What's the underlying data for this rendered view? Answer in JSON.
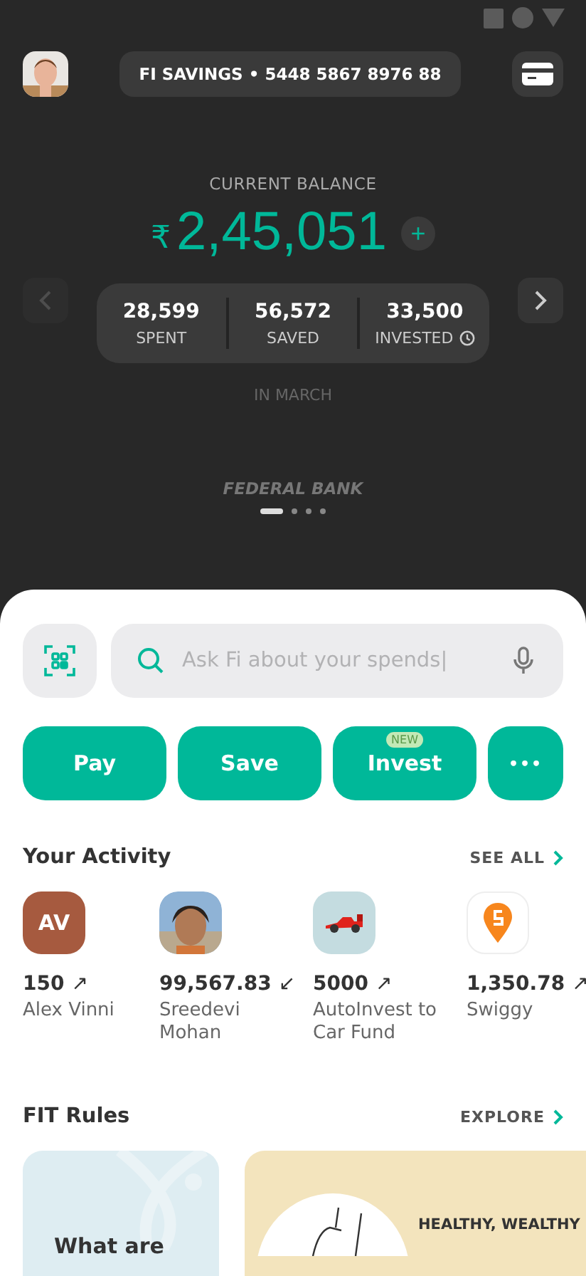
{
  "header": {
    "account": "FI SAVINGS • 5448 5867 8976 88"
  },
  "balance": {
    "label": "CURRENT BALANCE",
    "currency": "₹",
    "amount": "2,45,051",
    "plus": "+"
  },
  "nav": {
    "prev_disabled": true,
    "next_disabled": false
  },
  "stats": [
    {
      "value": "28,599",
      "label": "SPENT",
      "clock": false
    },
    {
      "value": "56,572",
      "label": "SAVED",
      "clock": false
    },
    {
      "value": "33,500",
      "label": "INVESTED",
      "clock": true
    }
  ],
  "period": "IN MARCH",
  "bank": "FEDERAL BANK",
  "pages": [
    {
      "selected": true
    },
    {
      "selected": false
    },
    {
      "selected": false
    },
    {
      "selected": false
    }
  ],
  "search": {
    "placeholder": "Ask Fi about your spends|"
  },
  "actions": [
    {
      "kind": "label",
      "label": "Pay"
    },
    {
      "kind": "label",
      "label": "Save"
    },
    {
      "kind": "label",
      "label": "Invest",
      "badge": "NEW"
    },
    {
      "kind": "more",
      "label": "•••"
    }
  ],
  "activity": {
    "title": "Your Activity",
    "link": "SEE ALL",
    "items": [
      {
        "kind": "initials",
        "initials": "AV",
        "color": "#a65a3f",
        "amount": "150",
        "arrow": "↗",
        "name": "Alex Vinni"
      },
      {
        "kind": "picture",
        "amount": "99,567.83",
        "arrow": "↙",
        "name": "Sreedevi Mohan"
      },
      {
        "kind": "car",
        "amount": "5000",
        "arrow": "↗",
        "name": "AutoInvest to Car Fund"
      },
      {
        "kind": "logo",
        "amount": "1,350.78",
        "arrow": "↗",
        "name": "Swiggy"
      }
    ]
  },
  "rules": {
    "title": "FIT Rules",
    "link": "EXPLORE",
    "cards": [
      {
        "kind": "question",
        "text": "What are"
      },
      {
        "kind": "illustration",
        "text": "HEALTHY, WEALTHY"
      }
    ]
  }
}
